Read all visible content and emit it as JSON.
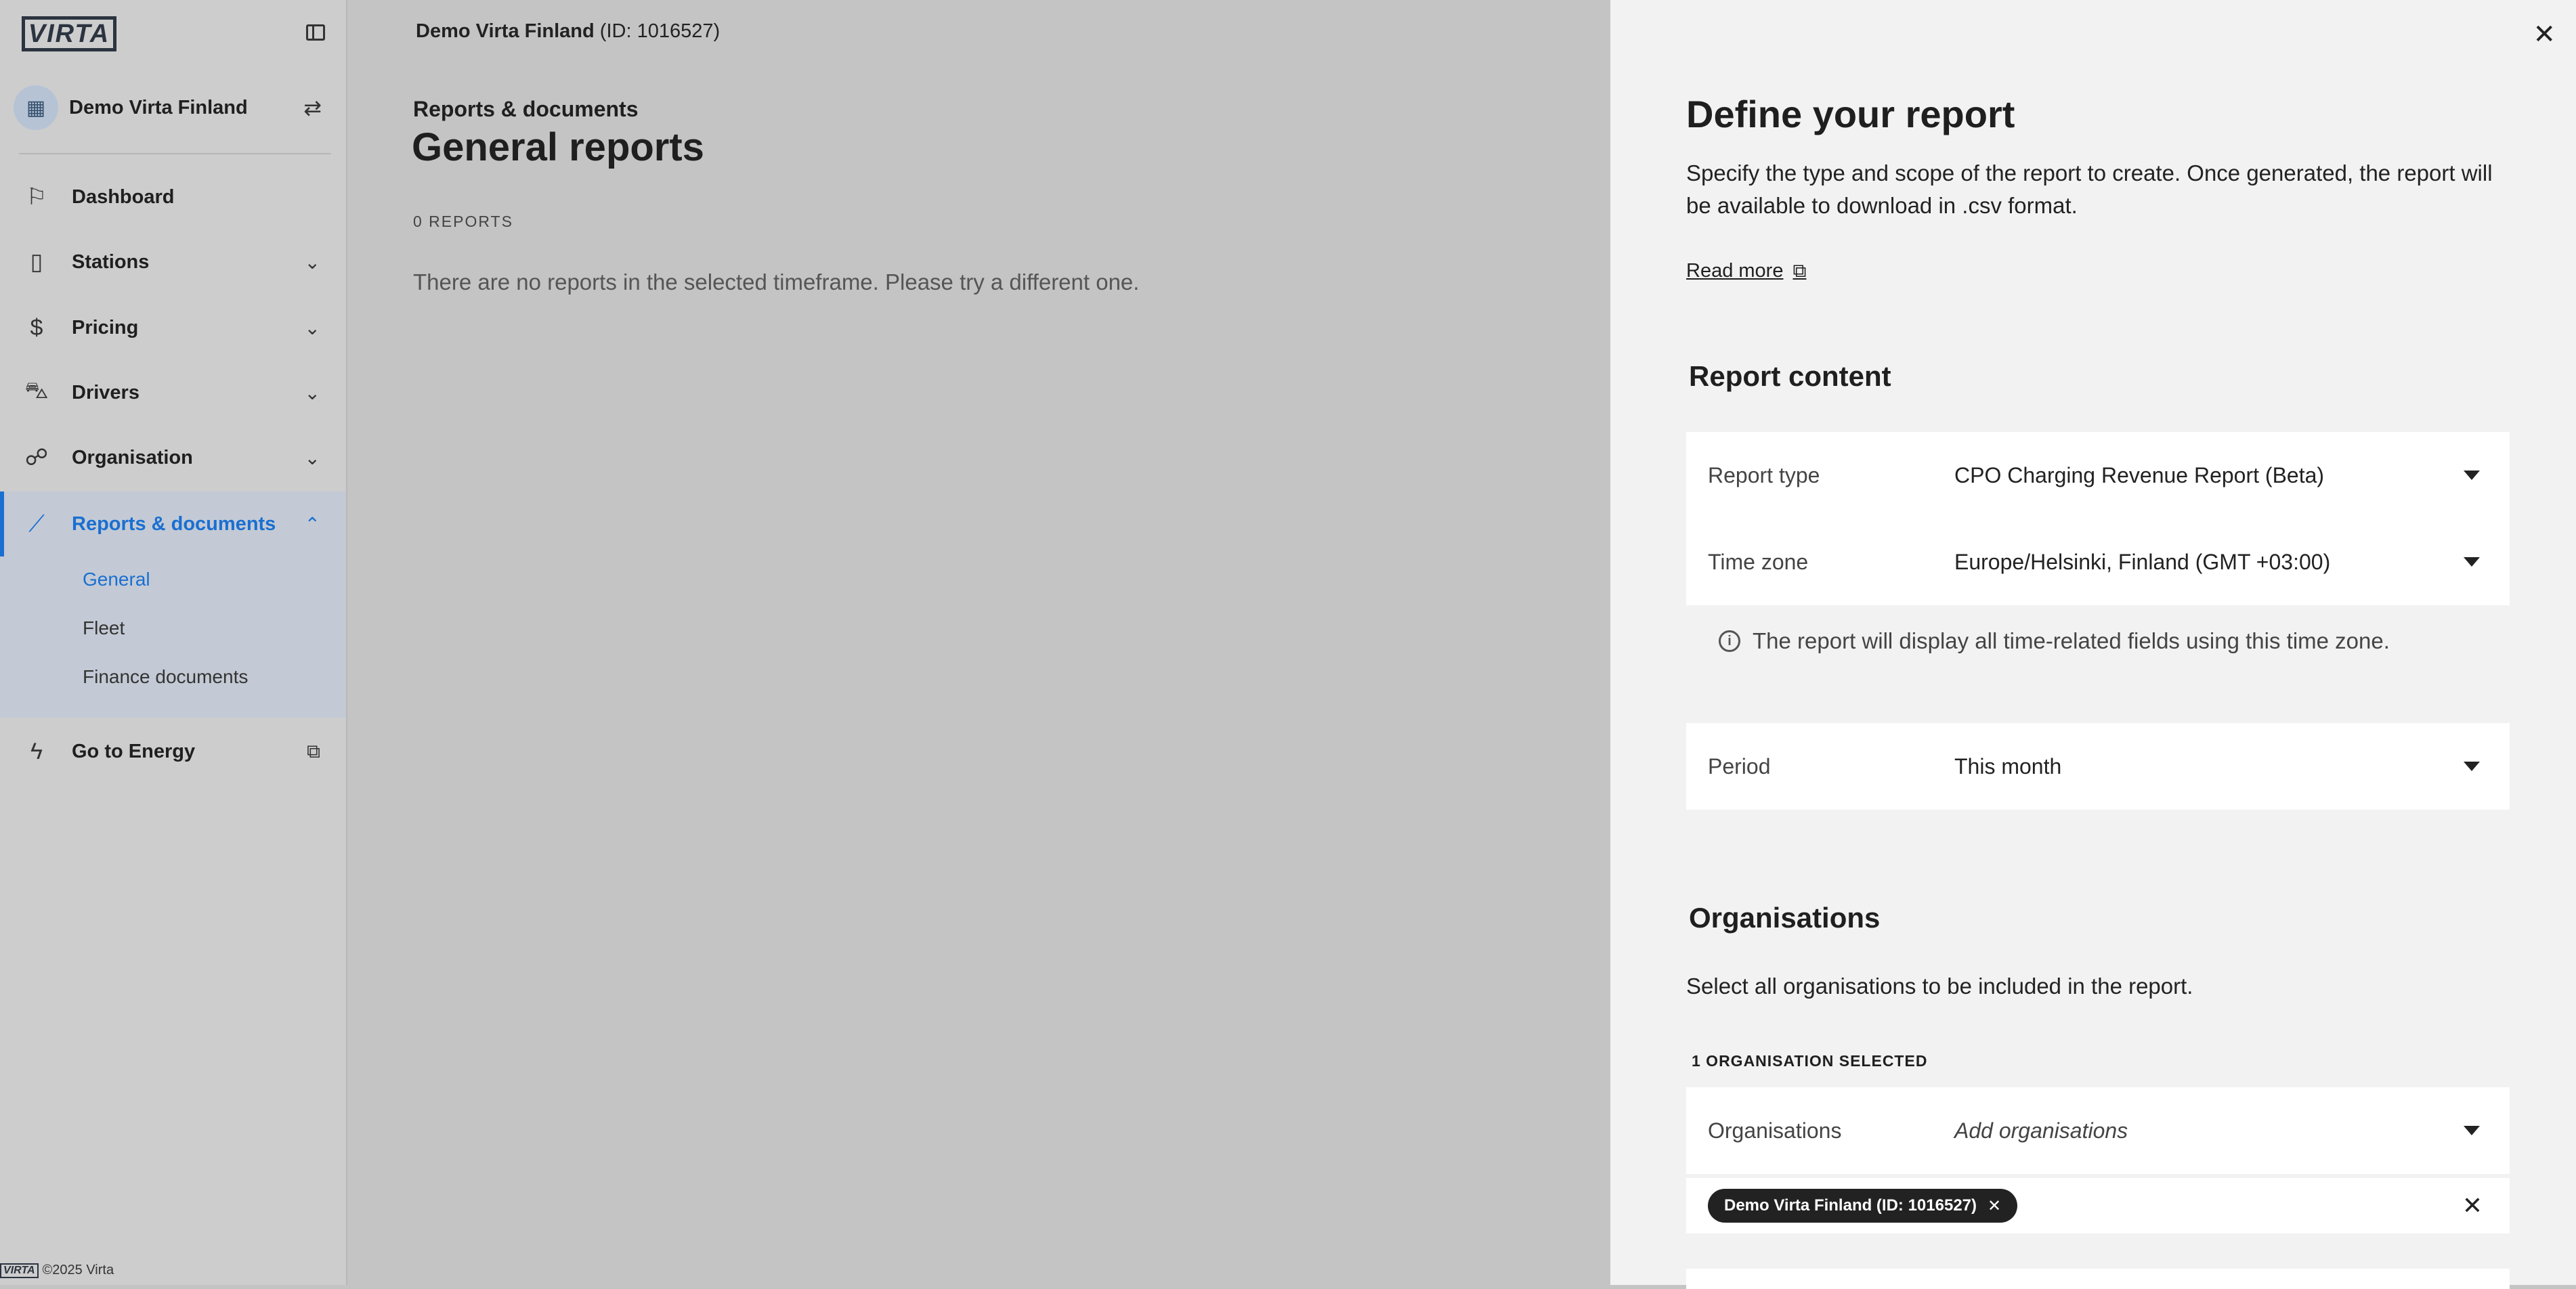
{
  "sidebar": {
    "logo_text": "VIRTA",
    "org_name": "Demo Virta Finland",
    "nav": [
      {
        "label": "Dashboard",
        "icon": "dashboard-icon"
      },
      {
        "label": "Stations",
        "icon": "station-icon"
      },
      {
        "label": "Pricing",
        "icon": "pricing-icon"
      },
      {
        "label": "Drivers",
        "icon": "driver-icon"
      },
      {
        "label": "Organisation",
        "icon": "organisation-icon"
      },
      {
        "label": "Reports & documents",
        "icon": "chart-icon"
      },
      {
        "label": "Go to Energy",
        "icon": "lightning-icon"
      }
    ],
    "sub_items": [
      "General",
      "Fleet",
      "Finance documents"
    ],
    "footer": "©2025 Virta",
    "footer_logo": "VIRTA"
  },
  "main": {
    "org_name": "Demo Virta Finland",
    "org_id": "(ID: 1016527)",
    "section": "Reports & documents",
    "title": "General reports",
    "reports_count": "0 REPORTS",
    "empty_message": "There are no reports in the selected timeframe. Please try a different one."
  },
  "panel": {
    "title": "Define your report",
    "description": "Specify the type and scope of the report to create. Once generated, the report will be available to download in .csv format.",
    "read_more": "Read more",
    "report_content_heading": "Report content",
    "report_type_label": "Report type",
    "report_type_value": "CPO Charging Revenue Report (Beta)",
    "time_zone_label": "Time zone",
    "time_zone_value": "Europe/Helsinki, Finland (GMT +03:00)",
    "time_zone_info": "The report will display all time-related fields using this time zone.",
    "period_label": "Period",
    "period_value": "This month",
    "organisations_heading": "Organisations",
    "organisations_desc": "Select all organisations to be included in the report.",
    "selected_count": "1 ORGANISATION SELECTED",
    "organisations_label": "Organisations",
    "organisations_placeholder": "Add organisations",
    "chip_label": "Demo Virta Finland (ID: 1016527)"
  },
  "colors": {
    "accent": "#1a6fd1",
    "overlay": "#c4c4c4",
    "panel_bg": "#f2f2f2"
  }
}
